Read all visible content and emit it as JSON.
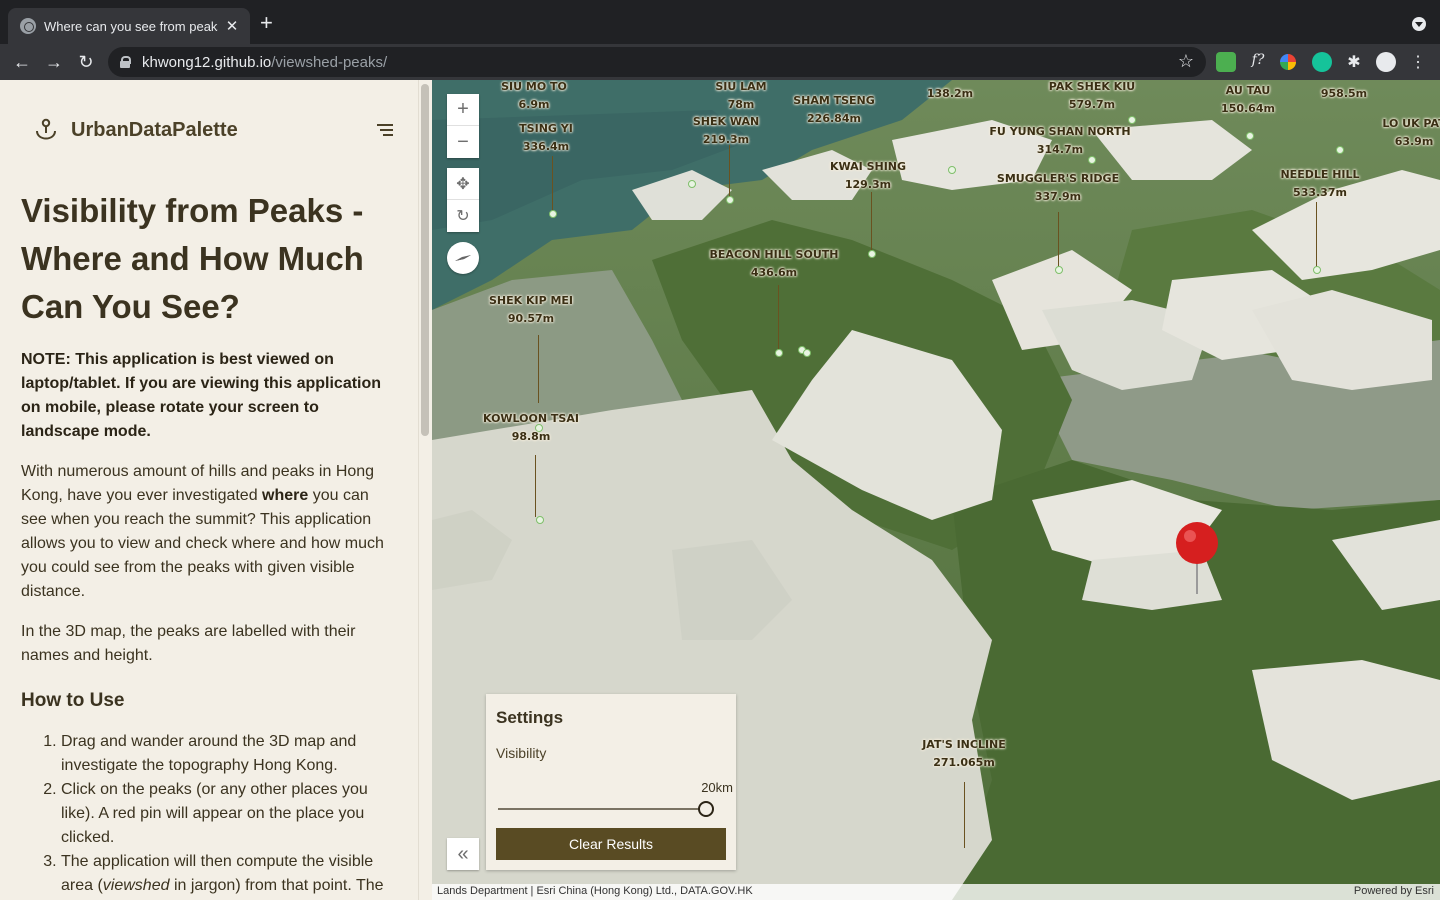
{
  "browser": {
    "tab_title": "Where can you see from peaks",
    "tab_close": "✕",
    "new_tab": "+",
    "url_host": "khwong12.github.io",
    "url_path": "/viewshed-peaks/",
    "back": "←",
    "forward": "→",
    "reload": "↻",
    "bookmark": "☆"
  },
  "sidebar": {
    "brand_name": "UrbanDataPalette",
    "title": "Visibility from Peaks - Where and How Much Can You See?",
    "note": "NOTE: This application is best viewed on laptop/tablet. If you are viewing this application on mobile, please rotate your screen to landscape mode.",
    "para1_before": "With numerous amount of hills and peaks in Hong Kong, have you ever investigated ",
    "para1_bold": "where",
    "para1_after": " you can see when you reach the summit? This application allows you to view and check where and how much you could see from the peaks with given visible distance.",
    "para2": "In the 3D map, the peaks are labelled with their names and height.",
    "how_to_title": "How to Use",
    "steps": [
      "Drag and wander around the 3D map and investigate the topography Hong Kong.",
      "Click on the peaks (or any other places you like). A red pin will appear on the place you clicked."
    ],
    "step3_before": "The application will then compute the visible area (",
    "step3_italic": "viewshed",
    "step3_after": " in jargon) from that point. The"
  },
  "map": {
    "peaks": [
      {
        "name": "SIU MO TO",
        "height": "6.9m"
      },
      {
        "name": "SIU LAM",
        "height": "78m"
      },
      {
        "name": "SHAM TSENG",
        "height": "226.84m"
      },
      {
        "name": "",
        "height": "138.2m"
      },
      {
        "name": "PAK SHEK KIU",
        "height": "579.7m"
      },
      {
        "name": "AU TAU",
        "height": "150.64m"
      },
      {
        "name": "",
        "height": "958.5m"
      },
      {
        "name": "LO UK PAT",
        "height": "63.9m"
      },
      {
        "name": "TSING YI",
        "height": "336.4m"
      },
      {
        "name": "SHEK WAN",
        "height": "219.3m"
      },
      {
        "name": "FU YUNG SHAN NORTH",
        "height": "314.7m"
      },
      {
        "name": "KWAI SHING",
        "height": "129.3m"
      },
      {
        "name": "SMUGGLER'S RIDGE",
        "height": "337.9m"
      },
      {
        "name": "NEEDLE HILL",
        "height": "533.37m"
      },
      {
        "name": "BEACON HILL SOUTH",
        "height": "436.6m"
      },
      {
        "name": "SHEK KIP MEI",
        "height": "90.57m"
      },
      {
        "name": "KOWLOON TSAI",
        "height": "98.8m"
      },
      {
        "name": "JAT'S INCLINE",
        "height": "271.065m"
      }
    ],
    "controls": {
      "zoom_in": "+",
      "zoom_out": "−",
      "pan": "✥",
      "rotate": "↻",
      "collapse": "«"
    },
    "settings": {
      "title": "Settings",
      "visibility_label": "Visibility",
      "slider_value": "20km",
      "slider_fraction": 1.0,
      "clear_button": "Clear Results"
    },
    "attribution": "Lands Department | Esri China (Hong Kong) Ltd., DATA.GOV.HK",
    "powered_by": "Powered by Esri"
  },
  "colors": {
    "sidebar_bg": "#f3efe6",
    "brand_text": "#4b4128",
    "button_bg": "#594b23",
    "pin": "#d61f1f",
    "forest": "#4f6f37",
    "viewshed": "#e6e4dc",
    "water": "#3f6e68"
  }
}
